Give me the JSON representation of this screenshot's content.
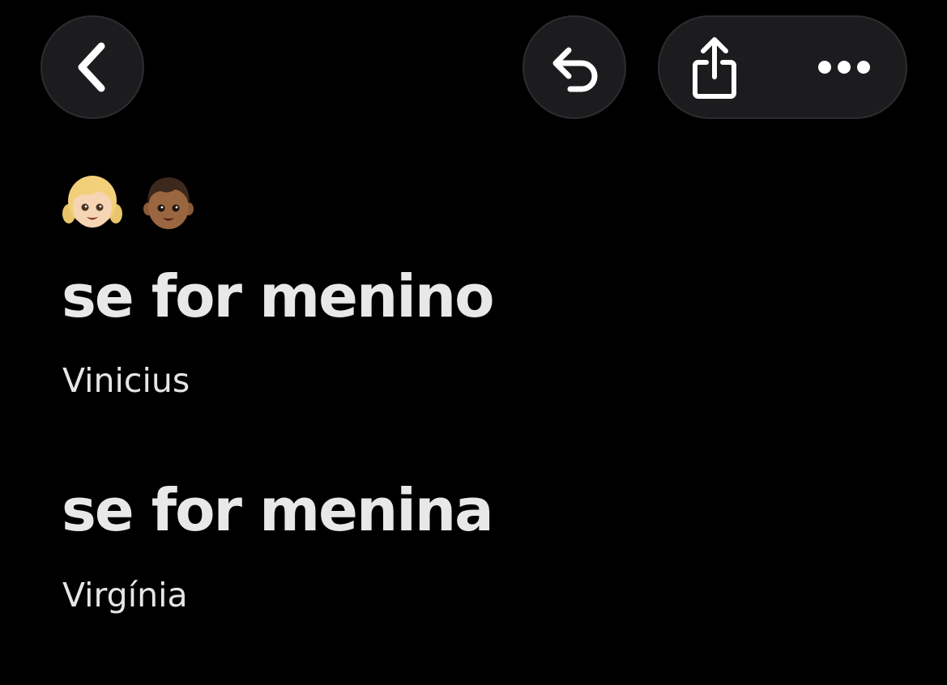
{
  "toolbar": {
    "back_icon": "chevron-left-icon",
    "undo_icon": "undo-arrow-icon",
    "share_icon": "share-icon",
    "more_icon": "ellipsis-icon"
  },
  "note": {
    "emojis": [
      "girl-light-skin-emoji",
      "boy-dark-skin-emoji"
    ],
    "sections": [
      {
        "heading": "se for menino",
        "name": "Vinicius"
      },
      {
        "heading": "se for menina",
        "name": "Virgínia"
      }
    ]
  },
  "colors": {
    "background": "#000000",
    "button_bg": "#1c1c1e",
    "text": "#e6e6e6"
  }
}
